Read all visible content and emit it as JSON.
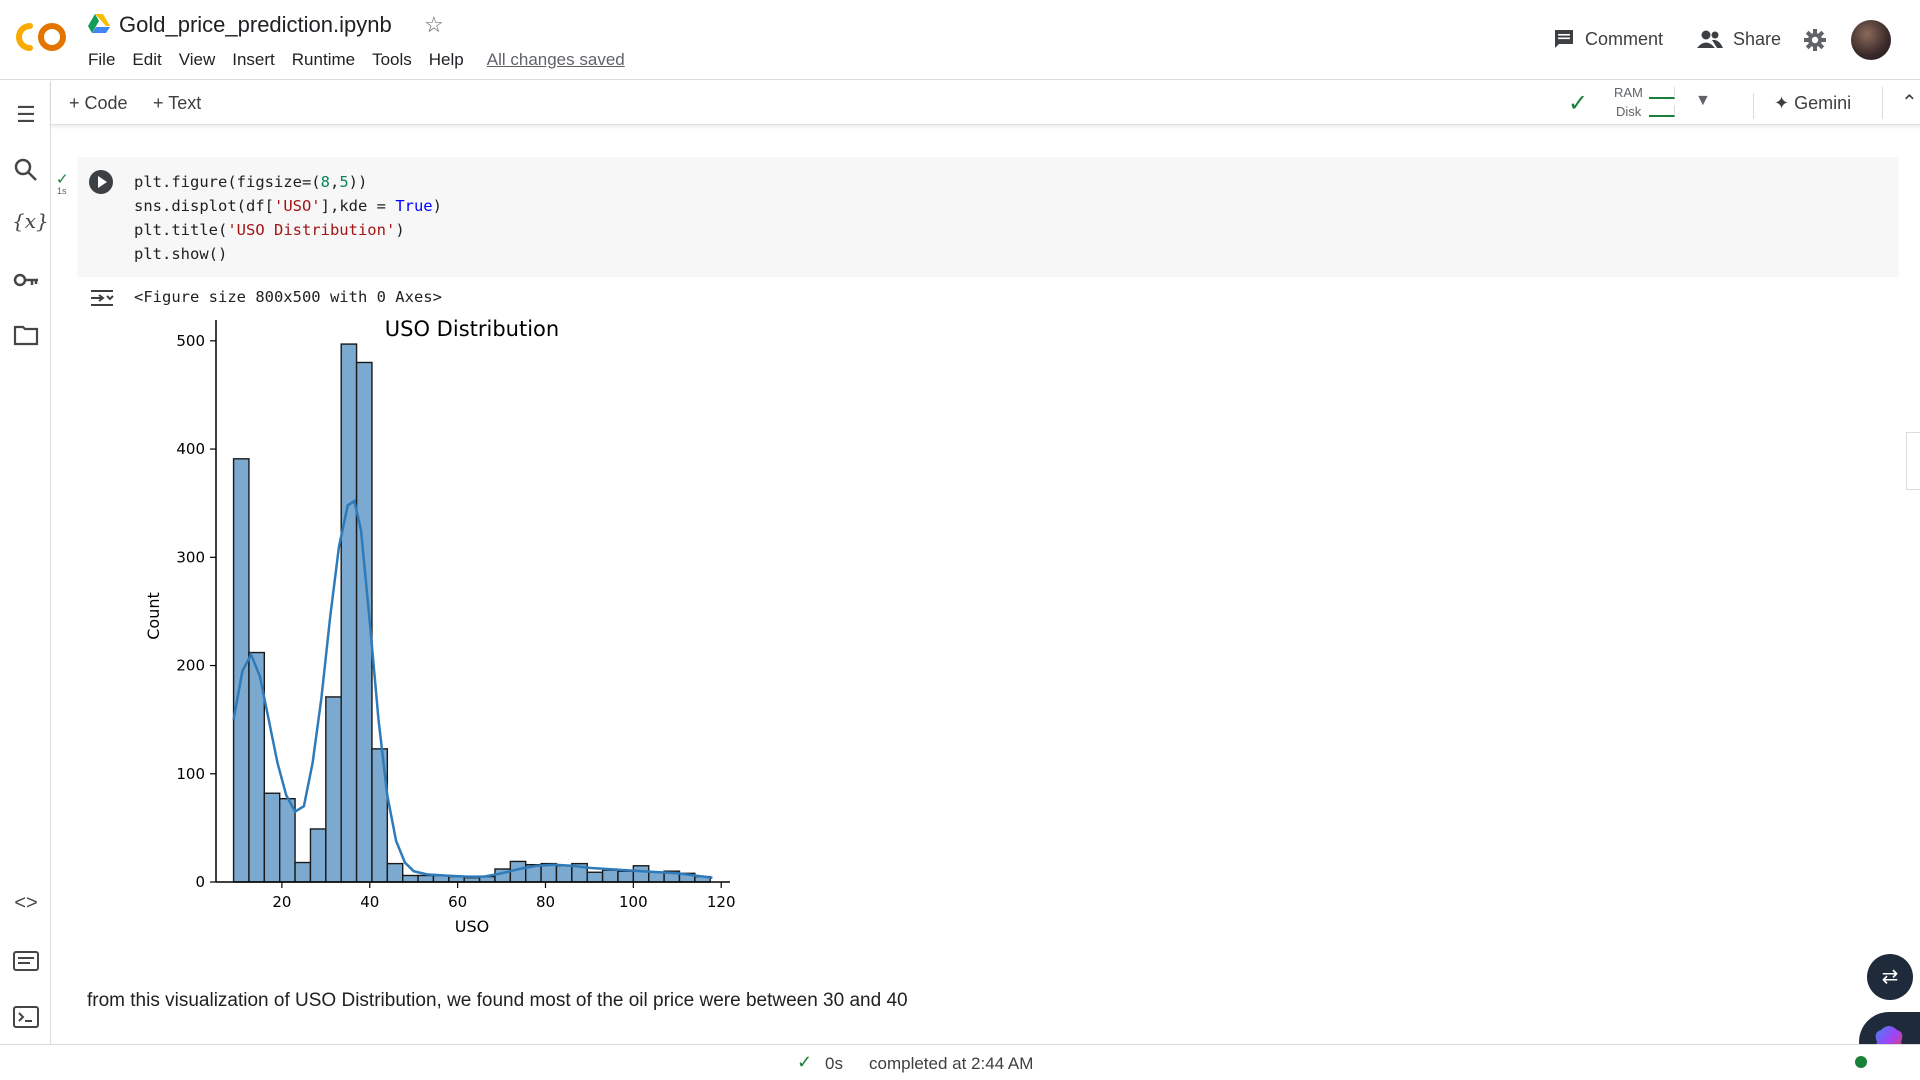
{
  "header": {
    "doc_title": "Gold_price_prediction.ipynb",
    "menu": [
      "File",
      "Edit",
      "View",
      "Insert",
      "Runtime",
      "Tools",
      "Help"
    ],
    "save_status": "All changes saved",
    "comment_label": "Comment",
    "share_label": "Share"
  },
  "toolbar": {
    "add_code": "+ Code",
    "add_text": "+ Text",
    "ram_label": "RAM",
    "disk_label": "Disk",
    "gemini_label": "Gemini"
  },
  "cell": {
    "exec_time": "1s",
    "code_lines": [
      "plt.figure(figsize=(8,5))",
      "sns.displot(df['USO'],kde = True)",
      "plt.title('USO Distribution')",
      "plt.show()"
    ],
    "output_text": "<Figure size 800x500 with 0 Axes>"
  },
  "chart_data": {
    "type": "bar",
    "title": "USO Distribution",
    "xlabel": "USO",
    "ylabel": "Count",
    "xlim": [
      5,
      122
    ],
    "ylim": [
      0,
      510
    ],
    "xticks": [
      20,
      40,
      60,
      80,
      100,
      120
    ],
    "yticks": [
      0,
      100,
      200,
      300,
      400,
      500
    ],
    "bin_width": 3.5,
    "bin_start": 9,
    "values": [
      391,
      212,
      82,
      77,
      18,
      49,
      171,
      497,
      480,
      123,
      17,
      6,
      6,
      6,
      5,
      4,
      5,
      12,
      19,
      16,
      17,
      15,
      17,
      9,
      11,
      10,
      15,
      9,
      10,
      8,
      5
    ],
    "kde": {
      "x": [
        9,
        11,
        13,
        15,
        17,
        19,
        21,
        23,
        25,
        27,
        29,
        31,
        33,
        35,
        36.5,
        38,
        40,
        42,
        44,
        46,
        48,
        50,
        53,
        57,
        62,
        66,
        70,
        74,
        78,
        82,
        86,
        90,
        94,
        98,
        102,
        106,
        110,
        114,
        118
      ],
      "y": [
        150,
        195,
        210,
        190,
        150,
        110,
        80,
        65,
        70,
        110,
        170,
        245,
        310,
        348,
        352,
        325,
        240,
        150,
        80,
        38,
        18,
        10,
        7,
        6,
        5,
        5,
        8,
        12,
        15,
        16,
        15,
        13,
        12,
        11,
        10,
        9,
        8,
        6,
        4
      ]
    },
    "bar_color": "#7ba9cf",
    "kde_color": "#2f7ab9"
  },
  "markdown": {
    "text": "from this visualization of USO Distribution, we found most of the oil price were between 30 and 40"
  },
  "status": {
    "duration": "0s",
    "completed": "completed at 2:44 AM"
  }
}
